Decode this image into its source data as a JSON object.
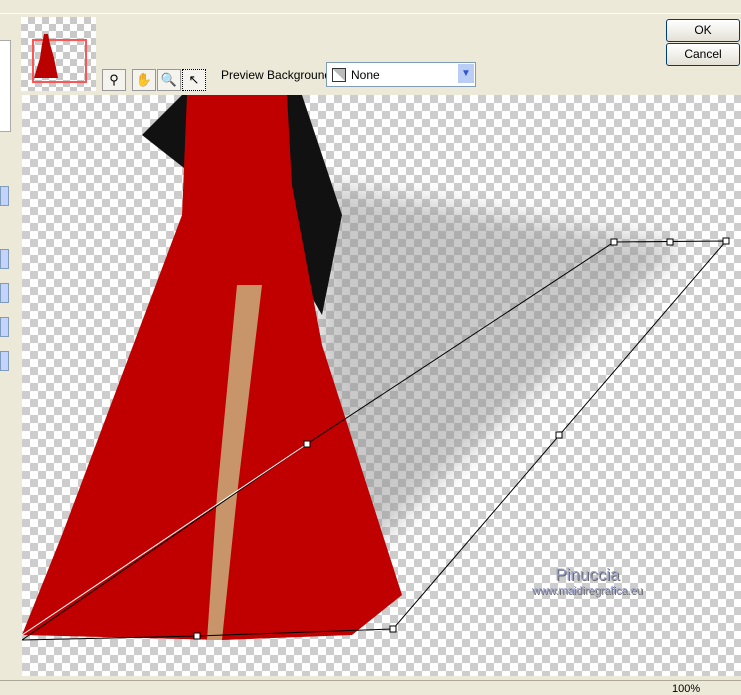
{
  "buttons": {
    "ok": "OK",
    "cancel": "Cancel"
  },
  "toolbar": {
    "tools": [
      "preview-toggle-icon",
      "pan-hand-icon",
      "zoom-magnifier-icon",
      "pointer-arrow-icon"
    ],
    "active_tool": "pointer-arrow-icon"
  },
  "preview_background": {
    "label": "Preview Background:",
    "value": "None"
  },
  "watermark": {
    "name": "Pinuccia",
    "url": "www.maidiregrafica.eu"
  },
  "status": {
    "zoom": "100%"
  },
  "colors": {
    "dress": "#c00000",
    "selection": "#ff5555",
    "accent": "#003c74"
  }
}
